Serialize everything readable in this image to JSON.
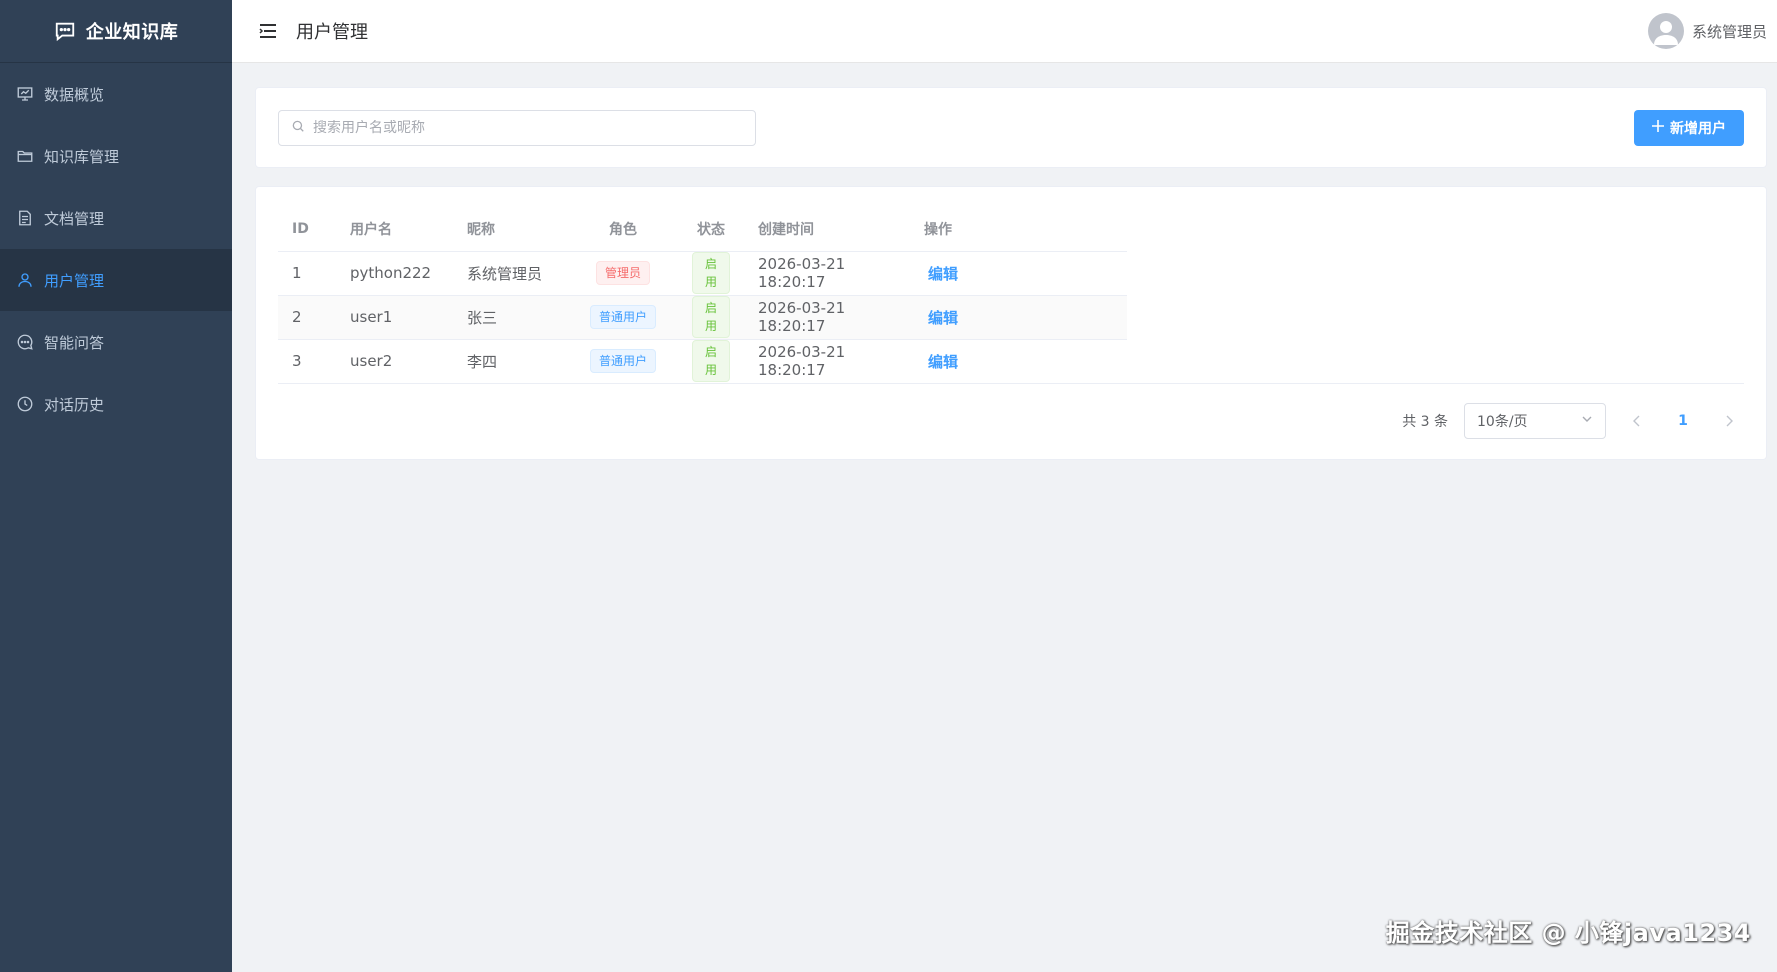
{
  "sidebar": {
    "brand_title": "企业知识库",
    "items": [
      {
        "label": "数据概览",
        "icon": "presentation-chart-icon"
      },
      {
        "label": "知识库管理",
        "icon": "folder-icon"
      },
      {
        "label": "文档管理",
        "icon": "document-icon"
      },
      {
        "label": "用户管理",
        "icon": "user-icon",
        "active": true
      },
      {
        "label": "智能问答",
        "icon": "chat-dots-icon"
      },
      {
        "label": "对话历史",
        "icon": "clock-icon"
      }
    ]
  },
  "header": {
    "title": "用户管理",
    "user_name": "系统管理员"
  },
  "search": {
    "placeholder": "搜索用户名或昵称",
    "value": ""
  },
  "toolbar": {
    "add_label": "新增用户"
  },
  "table": {
    "columns": [
      "ID",
      "用户名",
      "昵称",
      "角色",
      "状态",
      "创建时间",
      "操作"
    ],
    "rows": [
      {
        "id": "1",
        "username": "python222",
        "nickname": "系统管理员",
        "role": "管理员",
        "role_type": "danger",
        "status": "启用",
        "created": "2026-03-21 18:20:17",
        "action": "编辑"
      },
      {
        "id": "2",
        "username": "user1",
        "nickname": "张三",
        "role": "普通用户",
        "role_type": "info",
        "status": "启用",
        "created": "2026-03-21 18:20:17",
        "action": "编辑"
      },
      {
        "id": "3",
        "username": "user2",
        "nickname": "李四",
        "role": "普通用户",
        "role_type": "info",
        "status": "启用",
        "created": "2026-03-21 18:20:17",
        "action": "编辑"
      }
    ]
  },
  "pagination": {
    "total_text": "共 3 条",
    "page_size": "10条/页",
    "current_page": "1"
  },
  "watermark": "掘金技术社区 @ 小锋java1234",
  "colors": {
    "sidebar_bg": "#304156",
    "primary": "#409eff",
    "danger": "#f56c6c",
    "success": "#67c23a"
  }
}
